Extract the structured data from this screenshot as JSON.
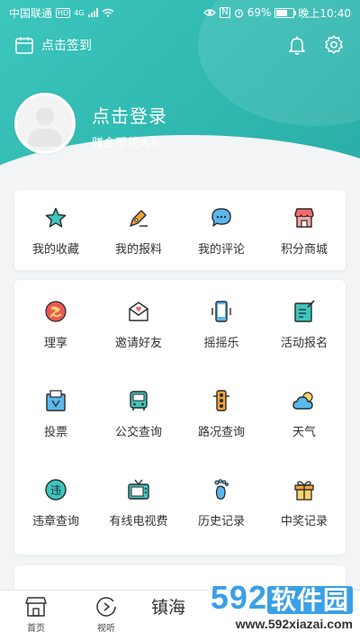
{
  "status_bar": {
    "carrier": "中国联通",
    "hd": "HD",
    "net": "4G",
    "battery": "69%",
    "battery_level": 0.69,
    "time": "晚上10:40"
  },
  "top_bar": {
    "checkin_label": "点击签到",
    "icons": [
      "calendar-icon",
      "bell-icon",
      "gear-icon"
    ]
  },
  "profile": {
    "title": "点击登录",
    "subtitle": "赚金币兑大礼"
  },
  "quick_actions": [
    {
      "label": "我的收藏",
      "icon": "star-icon"
    },
    {
      "label": "我的报料",
      "icon": "pen-icon"
    },
    {
      "label": "我的评论",
      "icon": "chat-icon"
    },
    {
      "label": "积分商城",
      "icon": "shop-icon"
    }
  ],
  "services": [
    {
      "label": "理享",
      "icon": "party-emblem-icon"
    },
    {
      "label": "邀请好友",
      "icon": "invite-envelope-icon"
    },
    {
      "label": "摇摇乐",
      "icon": "phone-shake-icon"
    },
    {
      "label": "活动报名",
      "icon": "signup-form-icon"
    },
    {
      "label": "投票",
      "icon": "vote-box-icon"
    },
    {
      "label": "公交查询",
      "icon": "bus-icon"
    },
    {
      "label": "路况查询",
      "icon": "traffic-light-icon"
    },
    {
      "label": "天气",
      "icon": "weather-icon"
    },
    {
      "label": "违章查询",
      "icon": "violation-icon"
    },
    {
      "label": "有线电视费",
      "icon": "tv-icon"
    },
    {
      "label": "历史记录",
      "icon": "footprint-icon"
    },
    {
      "label": "中奖记录",
      "icon": "gift-icon"
    }
  ],
  "tabbar": {
    "home": "首页",
    "video": "视听",
    "town": "镇海"
  },
  "watermark": {
    "brand_num": "592",
    "brand_cn": "软件园",
    "url": "www.592xiazai.com"
  },
  "colors": {
    "header": "#2fb8b0",
    "accent": "#3cc6bd"
  }
}
